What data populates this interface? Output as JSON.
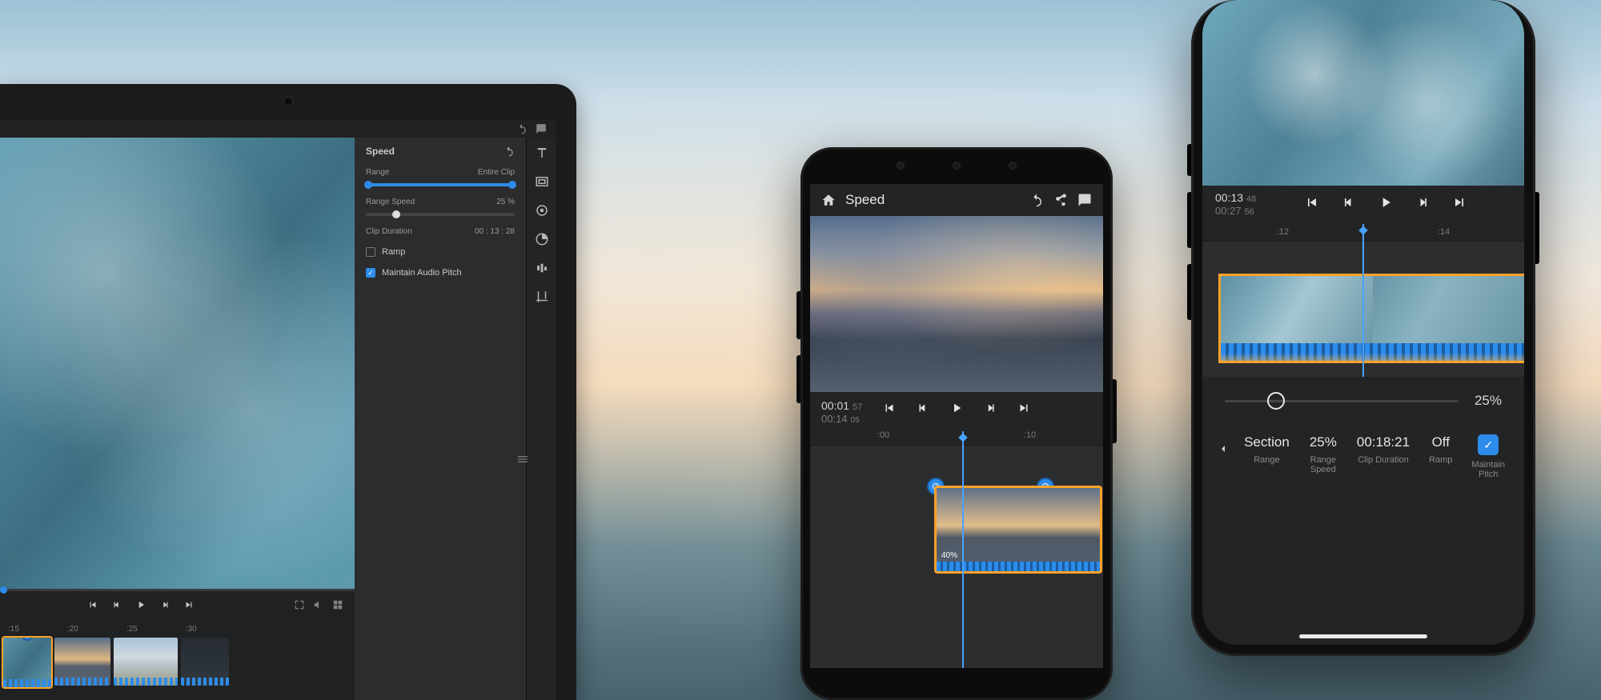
{
  "tablet": {
    "panel": {
      "title": "Speed",
      "range_label": "Range",
      "range_value": "Entire Clip",
      "speed_label": "Range Speed",
      "speed_value": "25 %",
      "duration_label": "Clip Duration",
      "duration_value": "00 : 13 : 28",
      "ramp_label": "Ramp",
      "ramp_checked": false,
      "pitch_label": "Maintain Audio Pitch",
      "pitch_checked": true
    },
    "ticks": [
      ":15",
      ":20",
      ":25",
      ":30"
    ],
    "tool_icons": [
      "titles-icon",
      "transform-icon",
      "audio-icon",
      "color-icon",
      "speed-icon",
      "crop-icon"
    ]
  },
  "phone_a": {
    "title": "Speed",
    "time_current": "00:01",
    "time_current_frames": "57",
    "time_total": "00:14",
    "time_total_frames": "05",
    "ticks": [
      ":00",
      ":10"
    ],
    "clip_pct": "40%"
  },
  "phone_b": {
    "time_current": "00:13",
    "time_current_frames": "48",
    "time_total": "00:27",
    "time_total_frames": "56",
    "ticks": [
      ":12",
      ":14"
    ],
    "slider_value": "25%",
    "controls": {
      "section": {
        "value": "Section",
        "label": "Range"
      },
      "speed": {
        "value": "25%",
        "label": "Range Speed"
      },
      "duration": {
        "value": "00:18:21",
        "label": "Clip Duration"
      },
      "ramp": {
        "value": "Off",
        "label": "Ramp"
      },
      "pitch": {
        "label": "Maintain Pitch",
        "checked": true
      }
    }
  }
}
